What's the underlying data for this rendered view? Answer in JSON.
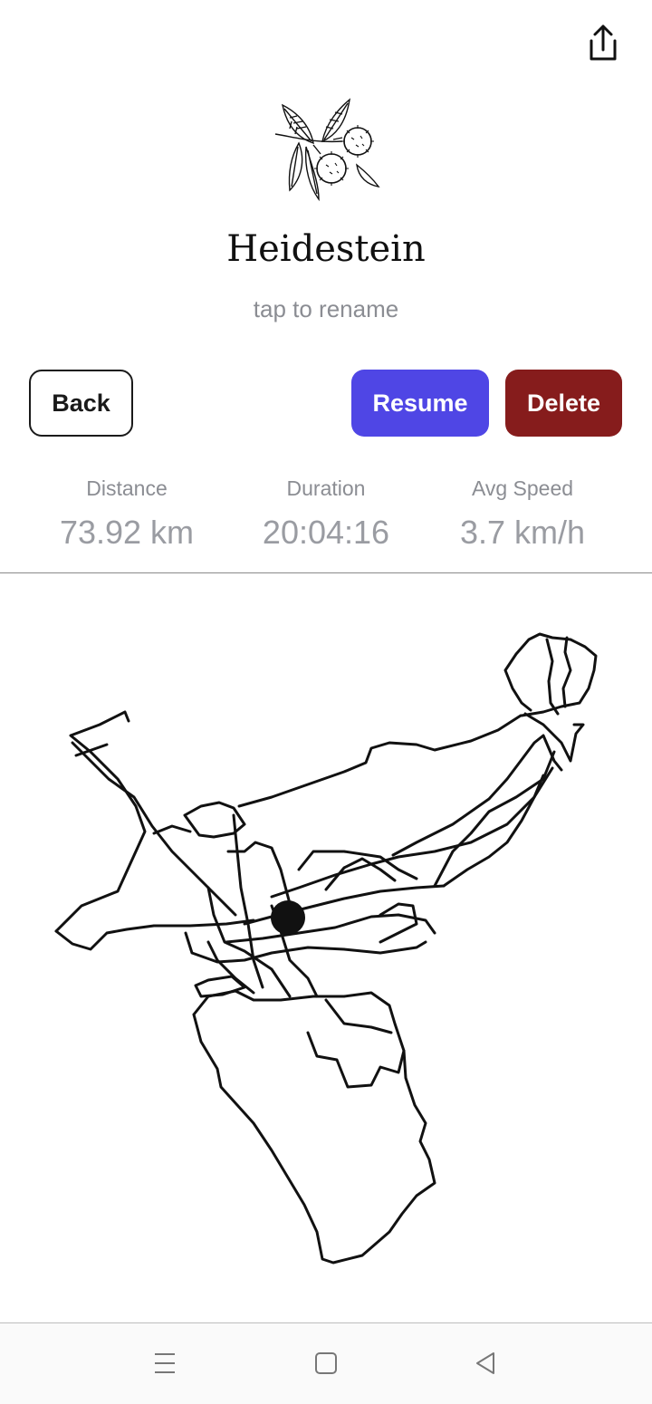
{
  "header": {
    "share_icon": "share-icon",
    "logo_icon": "chestnut-branch-illustration"
  },
  "track": {
    "name": "Heidestein",
    "rename_hint": "tap to rename"
  },
  "actions": {
    "back_label": "Back",
    "resume_label": "Resume",
    "delete_label": "Delete",
    "resume_color": "#4f46e5",
    "delete_color": "#861c1c"
  },
  "stats": [
    {
      "label": "Distance",
      "value": "73.92 km"
    },
    {
      "label": "Duration",
      "value": "20:04:16"
    },
    {
      "label": "Avg Speed",
      "value": "3.7 km/h"
    }
  ],
  "map": {
    "description_icon": "route-map"
  },
  "system_nav": {
    "menu_icon": "menu-icon",
    "home_icon": "home-icon",
    "back_icon": "back-triangle-icon"
  }
}
